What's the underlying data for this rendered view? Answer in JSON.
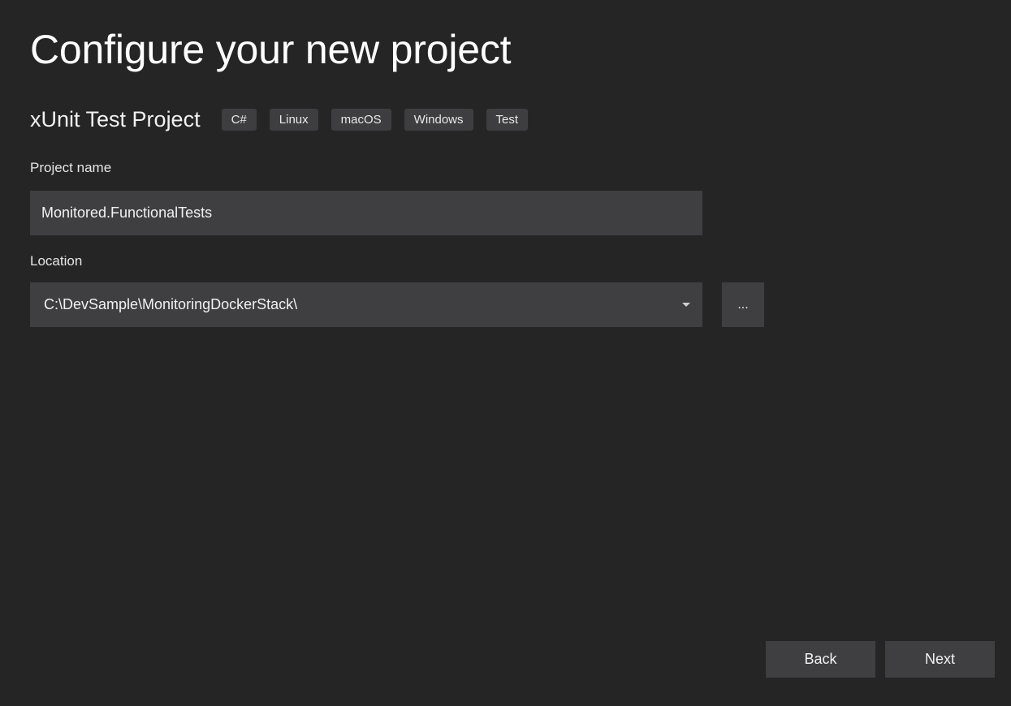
{
  "header": {
    "title": "Configure your new project"
  },
  "template": {
    "name": "xUnit Test Project",
    "tags": [
      "C#",
      "Linux",
      "macOS",
      "Windows",
      "Test"
    ]
  },
  "project_name": {
    "label": "Project name",
    "value": "Monitored.FunctionalTests"
  },
  "location": {
    "label": "Location",
    "value": "C:\\DevSample\\MonitoringDockerStack\\",
    "browse_label": "..."
  },
  "footer": {
    "back_label": "Back",
    "next_label": "Next"
  }
}
